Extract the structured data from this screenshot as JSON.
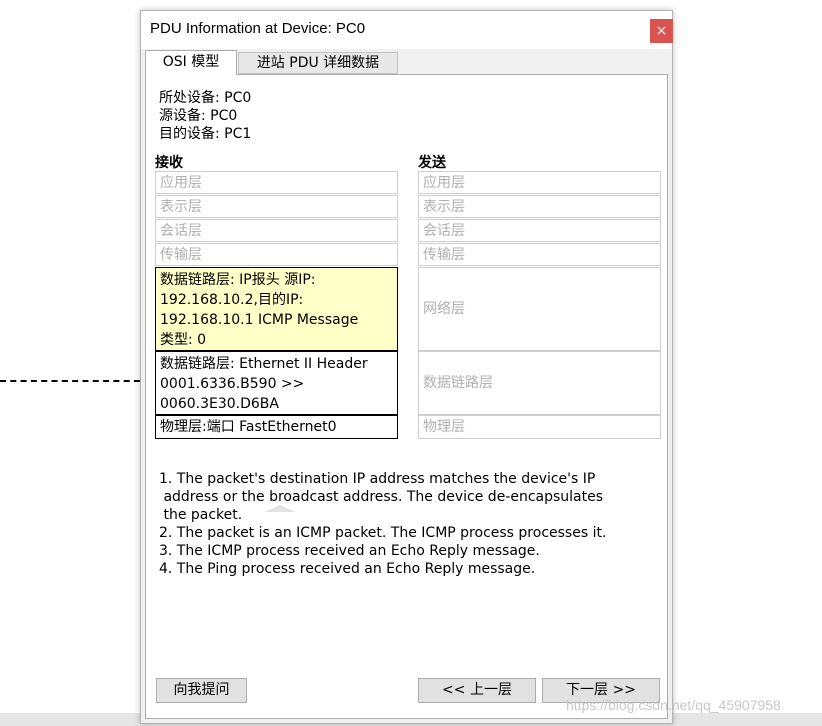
{
  "window": {
    "title": "PDU Information at Device: PC0",
    "close_glyph": "×"
  },
  "tabs": [
    {
      "label": "OSI 模型"
    },
    {
      "label": "进站 PDU 详细数据"
    }
  ],
  "info": {
    "current_device": "所处设备: PC0",
    "source_device": "源设备: PC0",
    "dest_device": "目的设备: PC1"
  },
  "in_column": {
    "heading": "接收",
    "layers": [
      {
        "text": "应用层"
      },
      {
        "text": "表示层"
      },
      {
        "text": "会话层"
      },
      {
        "text": "传输层"
      },
      {
        "lines": [
          "数据链路层: IP报头 源IP:",
          "192.168.10.2,目的IP:",
          "192.168.10.1 ICMP Message",
          "类型: 0"
        ]
      },
      {
        "lines": [
          "数据链路层: Ethernet II Header",
          "0001.6336.B590 >>",
          "0060.3E30.D6BA"
        ]
      },
      {
        "text": "物理层:端口 FastEthernet0"
      }
    ]
  },
  "out_column": {
    "heading": "发送",
    "layers": [
      {
        "text": "应用层"
      },
      {
        "text": "表示层"
      },
      {
        "text": "会话层"
      },
      {
        "text": "传输层"
      },
      {
        "text": "网络层"
      },
      {
        "text": "数据链路层"
      },
      {
        "text": "物理层"
      }
    ]
  },
  "steps": [
    "1. The packet's destination IP address matches the device's IP",
    " address or the broadcast address. The device de-encapsulates",
    " the packet.",
    "2. The packet is an ICMP packet. The ICMP process processes it.",
    "3. The ICMP process received an Echo Reply message.",
    "4. The Ping process received an Echo Reply message."
  ],
  "buttons": {
    "challenge": "向我提问",
    "prev": "<< 上一层",
    "next": "下一层 >>"
  },
  "watermark": "https://blog.csdn.net/qq_45907958",
  "colors": {
    "close": "#d9534f",
    "highlight": "#ffffc8"
  }
}
